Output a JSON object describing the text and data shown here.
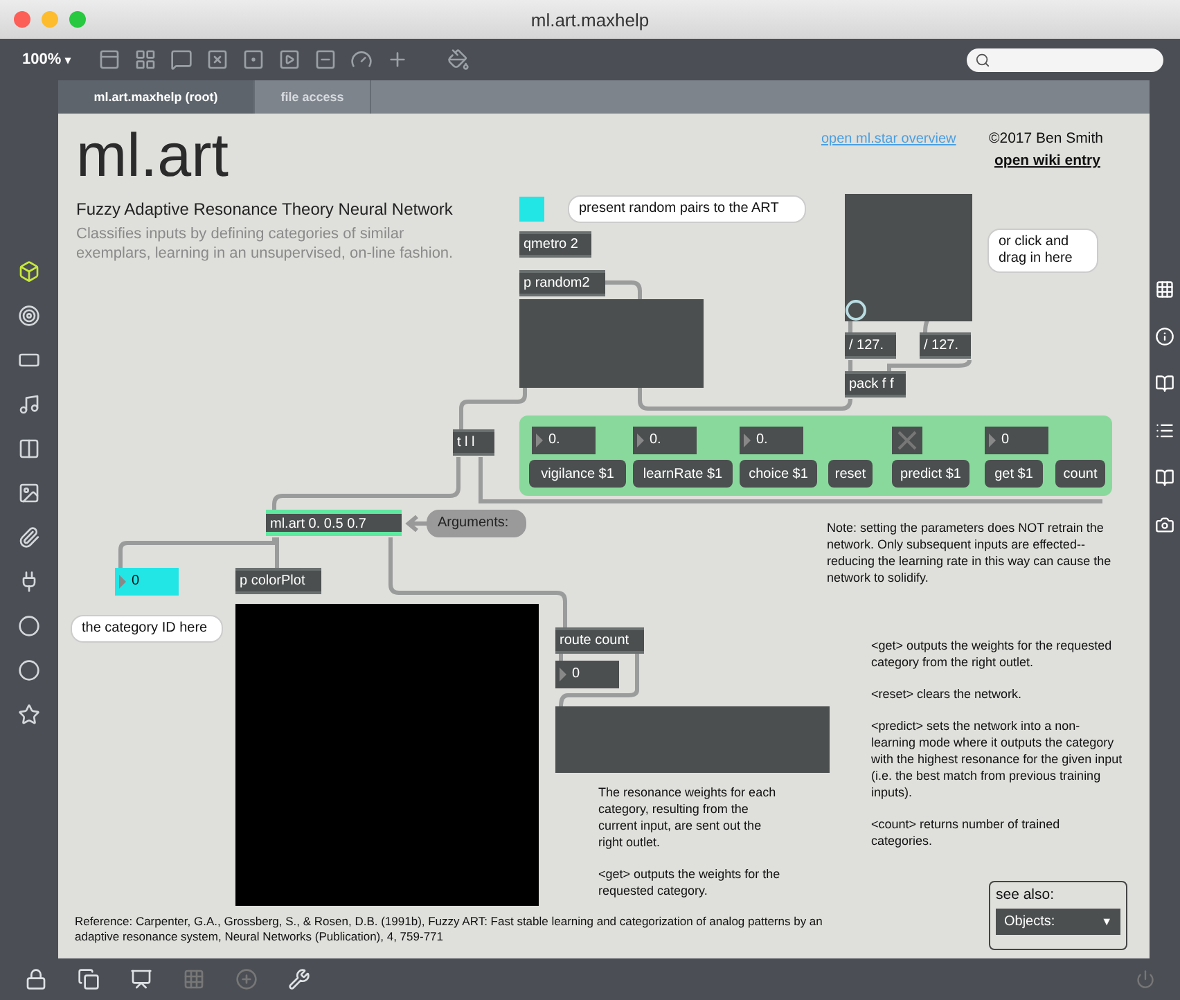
{
  "window": {
    "title": "ml.art.maxhelp"
  },
  "toolbar": {
    "zoom": "100%",
    "zoom_caret": "▾"
  },
  "tabs": [
    {
      "label": "ml.art.maxhelp (root)",
      "selected": true
    },
    {
      "label": "file access",
      "selected": false
    }
  ],
  "header": {
    "title": "ml.art",
    "subtitle": "Fuzzy Adaptive Resonance Theory Neural Network",
    "description": "Classifies inputs by defining categories of similar exemplars, learning in an unsupervised, on-line fashion.",
    "overview_link": "open ml.star overview",
    "copyright": "©2017 Ben Smith",
    "wiki_link": "open wiki entry"
  },
  "objects": [
    {
      "text": "qmetro 2",
      "selected": false
    },
    {
      "text": "p random2",
      "selected": false
    },
    {
      "text": "/ 127.",
      "selected": false
    },
    {
      "text": "/ 127.",
      "selected": false
    },
    {
      "text": "pack f f",
      "selected": false
    },
    {
      "text": "t l l",
      "selected": false
    },
    {
      "text": "ml.art 0. 0.5 0.7",
      "selected": true
    },
    {
      "text": "p colorPlot",
      "selected": false
    },
    {
      "text": "route count",
      "selected": false
    }
  ],
  "controls": [
    {
      "kind": "number",
      "text": "0."
    },
    {
      "kind": "number",
      "text": "0."
    },
    {
      "kind": "number",
      "text": "0."
    },
    {
      "kind": "toggle",
      "checked": false
    },
    {
      "kind": "number",
      "text": "0"
    }
  ],
  "messages": [
    "vigilance $1",
    "learnRate $1",
    "choice $1",
    "reset",
    "predict $1",
    "get $1",
    "count"
  ],
  "outputs": [
    {
      "text": "0",
      "color": "#22e6e6"
    },
    {
      "text": "0",
      "color": "#4b4f4f"
    }
  ],
  "bubbles": [
    {
      "text": "present random pairs to the ART",
      "kind": "white"
    },
    {
      "text": "or click and drag in here",
      "kind": "white"
    },
    {
      "text": "Arguments:",
      "kind": "grey"
    },
    {
      "text": "the category ID here",
      "kind": "white"
    }
  ],
  "comments": [
    {
      "paragraphs": [
        "Note: setting the parameters does NOT retrain the network. Only subsequent inputs are effected--reducing the learning rate in this way can cause the network to solidify."
      ]
    },
    {
      "paragraphs": [
        "<get> outputs the weights for the requested category from the right outlet.",
        "<reset> clears the network.",
        "<predict> sets the network into a non-learning mode where it outputs the category with the highest resonance for the given input (i.e. the best match from previous training inputs).",
        "<count> returns number of trained categories."
      ]
    },
    {
      "paragraphs": [
        "The resonance weights for each category, resulting from the current input, are sent out the right outlet.",
        "<get> outputs the weights for the requested category."
      ]
    }
  ],
  "reference": "Reference: Carpenter, G.A., Grossberg, S., & Rosen, D.B. (1991b), Fuzzy ART: Fast stable learning and categorization of analog patterns by an adaptive resonance system, Neural Networks (Publication), 4, 759-771",
  "see_also": {
    "label": "see also:",
    "menu": "Objects:",
    "caret": "▼"
  }
}
